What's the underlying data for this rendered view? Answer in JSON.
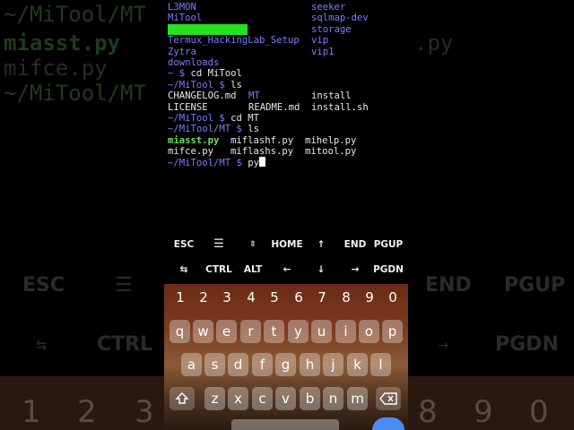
{
  "terminal": {
    "top_rows": [
      {
        "left": "L3MON",
        "right": "seeker"
      },
      {
        "left": "MiTool",
        "right": "sqlmap-dev"
      },
      {
        "left": "",
        "right": "storage"
      },
      {
        "left": "Termux_HackingLab_Setup",
        "right": "vip"
      },
      {
        "left": "Zytra",
        "right": "vip1"
      },
      {
        "left": "downloads",
        "right": ""
      }
    ],
    "cmd1_prompt": "~ $ ",
    "cmd1": "cd MiTool",
    "cmd2_prompt": "~/MiTool $ ",
    "cmd2": "ls",
    "ls1_rows": [
      {
        "c1": "CHANGELOG.md",
        "c2": "MT",
        "c3": "install"
      },
      {
        "c1": "LICENSE",
        "c2": "README.md",
        "c3": "install.sh"
      }
    ],
    "cmd3_prompt": "~/MiTool $ ",
    "cmd3": "cd MT",
    "cmd4_prompt": "~/MiTool/MT $ ",
    "cmd4": "ls",
    "ls2_rows": [
      {
        "c1": "miasst.py",
        "c2": "miflashf.py",
        "c3": "mihelp.py"
      },
      {
        "c1": "mifce.py",
        "c2": "miflashs.py",
        "c3": "mitool.py"
      }
    ],
    "cmd5_prompt": "~/MiTool/MT $ ",
    "cmd5": "py"
  },
  "extra_keys": {
    "row1": [
      "ESC",
      "☰",
      "⇳",
      "HOME",
      "↑",
      "END",
      "PGUP"
    ],
    "row2": [
      "⇆",
      "CTRL",
      "ALT",
      "←",
      "↓",
      "→",
      "PGDN"
    ]
  },
  "keyboard": {
    "numbers": [
      "1",
      "2",
      "3",
      "4",
      "5",
      "6",
      "7",
      "8",
      "9",
      "0"
    ],
    "row_q": [
      "q",
      "w",
      "e",
      "r",
      "t",
      "y",
      "u",
      "i",
      "o",
      "p"
    ],
    "row_a": [
      "a",
      "s",
      "d",
      "f",
      "g",
      "h",
      "j",
      "k",
      "l"
    ],
    "row_z": [
      "z",
      "x",
      "c",
      "v",
      "b",
      "n",
      "m"
    ],
    "shift_icon": "shift-icon",
    "backspace_icon": "backspace-icon"
  },
  "background": {
    "line1": "~/MiTool/MT",
    "line2a": "miasst.py",
    "line2b": ".py",
    "line3": "mifce.py",
    "line4": "~/MiTool/MT",
    "keys1": [
      "ESC",
      "☰",
      "END",
      "PGUP"
    ],
    "keys2": [
      "⇆",
      "CTRL",
      "→",
      "PGDN"
    ],
    "nums": [
      "1",
      "2",
      "3",
      "8",
      "9",
      "0"
    ]
  },
  "colors": {
    "prompt": "#7a7cff",
    "executable": "#67e06a",
    "selection": "#28e11e"
  }
}
